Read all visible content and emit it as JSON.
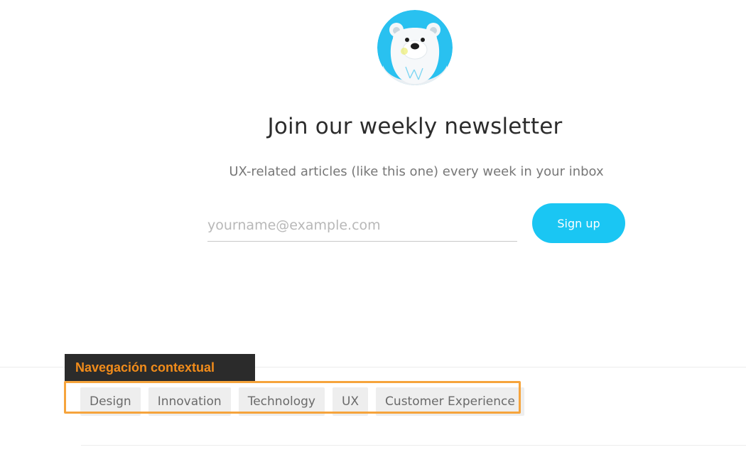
{
  "newsletter": {
    "title": "Join our weekly newsletter",
    "subtitle": "UX-related articles (like this one) every week in your inbox",
    "email_placeholder": "yourname@example.com",
    "email_value": "",
    "signup_label": "Sign up",
    "avatar_icon": "polar-bear-icon"
  },
  "annotation": {
    "label": "Navegación contextual"
  },
  "tags": [
    {
      "label": "Design"
    },
    {
      "label": "Innovation"
    },
    {
      "label": "Technology"
    },
    {
      "label": "UX"
    },
    {
      "label": "Customer Experience"
    }
  ],
  "colors": {
    "accent": "#1ac6f3",
    "annotation_orange": "#f6a43c",
    "annotation_bg": "#2b2b2b"
  }
}
